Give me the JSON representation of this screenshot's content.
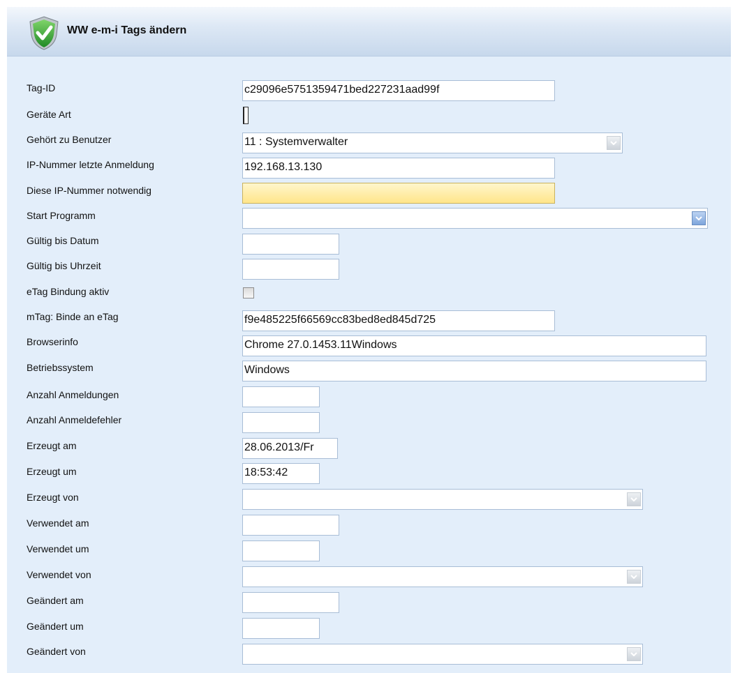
{
  "header": {
    "title": "WW e-m-i Tags ändern",
    "icon": "shield-check-icon"
  },
  "form": {
    "tag_id": {
      "label": "Tag-ID",
      "value": "c29096e5751359471bed227231aad99f"
    },
    "geraete_art": {
      "label": "Geräte Art",
      "value": ""
    },
    "benutzer": {
      "label": "Gehört zu Benutzer",
      "value": "11 : Systemverwalter"
    },
    "ip_letzte": {
      "label": "IP-Nummer letzte Anmeldung",
      "value": "192.168.13.130"
    },
    "ip_notwendig": {
      "label": "Diese IP-Nummer notwendig",
      "value": ""
    },
    "start_programm": {
      "label": "Start Programm",
      "value": ""
    },
    "gueltig_datum": {
      "label": "Gültig bis Datum",
      "value": ""
    },
    "gueltig_uhrzeit": {
      "label": "Gültig bis Uhrzeit",
      "value": ""
    },
    "etag_bindung": {
      "label": "eTag Bindung aktiv",
      "checked": false
    },
    "mtag_binde": {
      "label": "mTag: Binde an eTag",
      "value": "f9e485225f66569cc83bed8ed845d725"
    },
    "browserinfo": {
      "label": "Browserinfo",
      "value": "Chrome 27.0.1453.11Windows"
    },
    "betriebssystem": {
      "label": "Betriebssystem",
      "value": "Windows"
    },
    "anzahl_anmeldungen": {
      "label": "Anzahl Anmeldungen",
      "value": ""
    },
    "anzahl_anmeldefehler": {
      "label": "Anzahl Anmeldefehler",
      "value": ""
    },
    "erzeugt_am": {
      "label": "Erzeugt am",
      "value": "28.06.2013/Fr"
    },
    "erzeugt_um": {
      "label": "Erzeugt um",
      "value": "18:53:42"
    },
    "erzeugt_von": {
      "label": "Erzeugt von",
      "value": ""
    },
    "verwendet_am": {
      "label": "Verwendet am",
      "value": ""
    },
    "verwendet_um": {
      "label": "Verwendet um",
      "value": ""
    },
    "verwendet_von": {
      "label": "Verwendet von",
      "value": ""
    },
    "geaendert_am": {
      "label": "Geändert am",
      "value": ""
    },
    "geaendert_um": {
      "label": "Geändert um",
      "value": ""
    },
    "geaendert_von": {
      "label": "Geändert von",
      "value": ""
    }
  },
  "colors": {
    "panel_bg": "#e3eefa",
    "field_border": "#a8bdd6",
    "required_yellow": "#ffe58a"
  }
}
